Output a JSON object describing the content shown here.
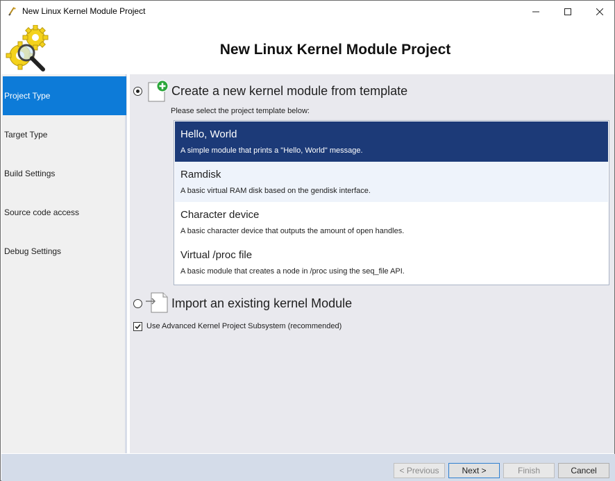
{
  "window": {
    "title": "New Linux Kernel Module Project"
  },
  "header": {
    "heading": "New Linux Kernel Module Project"
  },
  "sidebar": {
    "items": [
      {
        "label": "Project Type",
        "active": true
      },
      {
        "label": "Target Type"
      },
      {
        "label": "Build Settings"
      },
      {
        "label": "Source code access"
      },
      {
        "label": "Debug Settings"
      }
    ]
  },
  "main": {
    "option_template": {
      "label": "Create a new kernel module from template",
      "checked": true
    },
    "hint": "Please select the project template below:",
    "templates": [
      {
        "name": "Hello, World",
        "description": "A simple module that prints a \"Hello, World\" message.",
        "selected": true
      },
      {
        "name": "Ramdisk",
        "description": "A basic virtual RAM disk based on the gendisk interface."
      },
      {
        "name": "Character device",
        "description": "A basic character device that outputs the amount of open handles."
      },
      {
        "name": "Virtual /proc file",
        "description": "A basic module that creates a node in /proc using the seq_file API."
      }
    ],
    "option_import": {
      "label": "Import an existing kernel Module",
      "checked": false
    },
    "advanced_checkbox": {
      "label": "Use Advanced Kernel Project Subsystem (recommended)",
      "checked": true
    }
  },
  "footer": {
    "previous": "< Previous",
    "next": "Next >",
    "finish": "Finish",
    "cancel": "Cancel"
  },
  "colors": {
    "sidebar_active": "#0d7bd8",
    "selected_template": "#1c3a78",
    "footer": "#d4dce9"
  }
}
